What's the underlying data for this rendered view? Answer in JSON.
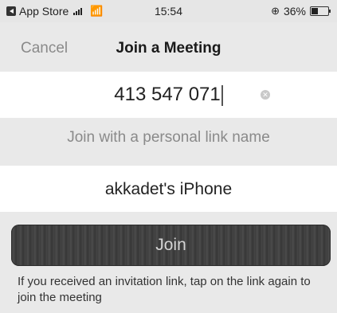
{
  "status_bar": {
    "carrier": "App Store",
    "time": "15:54",
    "battery_percent": "36%"
  },
  "nav": {
    "cancel_label": "Cancel",
    "title": "Join a Meeting"
  },
  "meeting_id": {
    "value": "413 547 071"
  },
  "personal_link_label": "Join with a personal link name",
  "screen_name": {
    "value": "akkadet's iPhone"
  },
  "join_button": {
    "label": "Join"
  },
  "hint_text": "If you received an invitation link, tap on the link again to join the meeting",
  "icons": {
    "back": "back-to-app-icon",
    "signal": "cellular-signal-icon",
    "wifi": "wifi-icon",
    "location": "location-icon",
    "battery": "battery-icon",
    "clear": "clear-text-icon"
  },
  "colors": {
    "background": "#e9e9e9",
    "field_background": "#ffffff",
    "button": "#3f3f3f",
    "muted_text": "#8a8a8a"
  }
}
